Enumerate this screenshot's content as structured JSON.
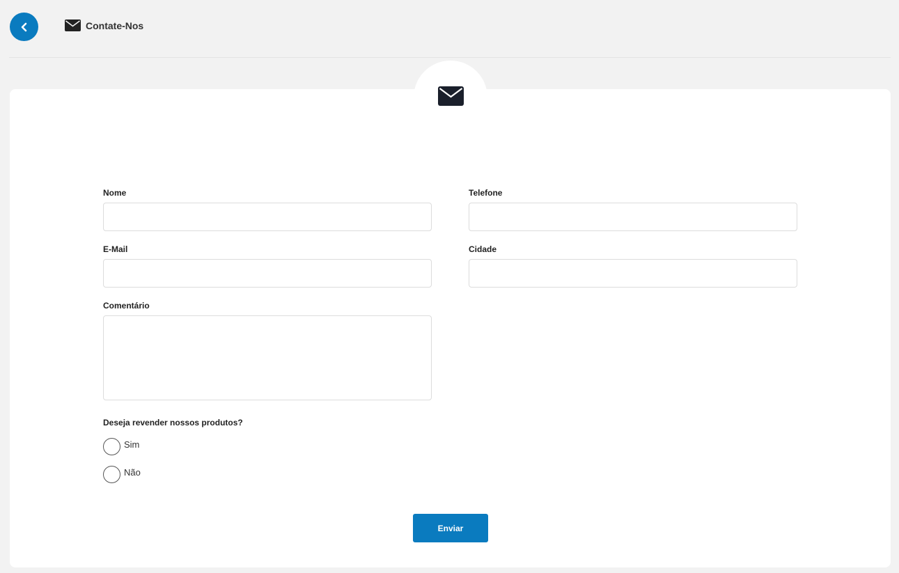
{
  "header": {
    "title": "Contate-Nos",
    "back_icon": "chevron-left-icon",
    "title_icon": "envelope-icon"
  },
  "card": {
    "icon": "envelope-icon"
  },
  "form": {
    "nome_label": "Nome",
    "nome_value": "",
    "telefone_label": "Telefone",
    "telefone_value": "",
    "email_label": "E-Mail",
    "email_value": "",
    "cidade_label": "Cidade",
    "cidade_value": "",
    "comentario_label": "Comentário",
    "comentario_value": "",
    "revender_question": "Deseja revender nossos produtos?",
    "options": [
      "Sim",
      "Não"
    ],
    "selected_option": null,
    "submit_label": "Enviar"
  },
  "colors": {
    "accent": "#0a7bbf",
    "page_background": "#f2f2f2",
    "card_background": "#ffffff"
  }
}
